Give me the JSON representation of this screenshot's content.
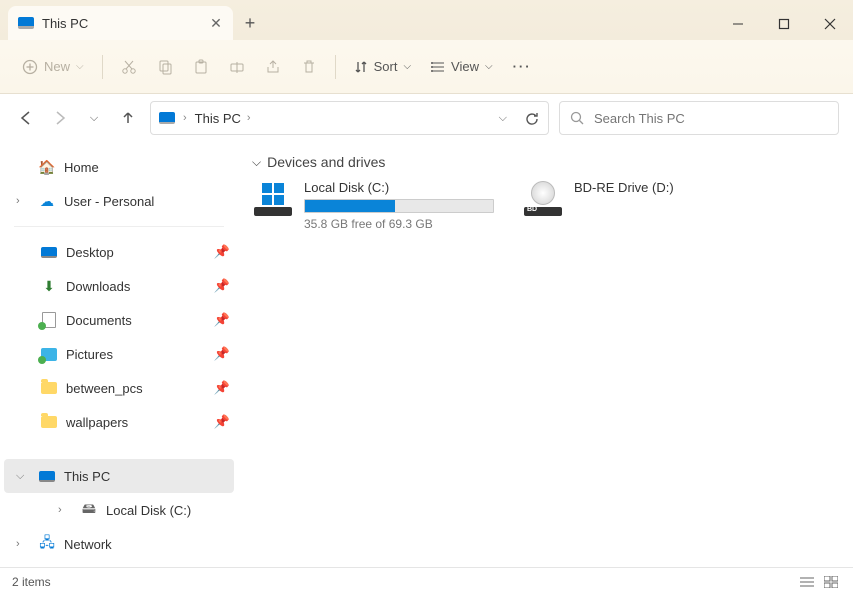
{
  "tab": {
    "title": "This PC"
  },
  "toolbar": {
    "new_label": "New",
    "sort_label": "Sort",
    "view_label": "View"
  },
  "address": {
    "location": "This PC",
    "search_placeholder": "Search This PC"
  },
  "sidebar": {
    "home": "Home",
    "user": "User - Personal",
    "quick": [
      {
        "label": "Desktop"
      },
      {
        "label": "Downloads"
      },
      {
        "label": "Documents"
      },
      {
        "label": "Pictures"
      },
      {
        "label": "between_pcs"
      },
      {
        "label": "wallpapers"
      }
    ],
    "this_pc": "This PC",
    "local_disk": "Local Disk (C:)",
    "network": "Network"
  },
  "content": {
    "group_header": "Devices and drives",
    "drives": [
      {
        "name": "Local Disk (C:)",
        "subtext": "35.8 GB free of 69.3 GB",
        "fill_pct": 48
      },
      {
        "name": "BD-RE Drive (D:)",
        "subtext": ""
      }
    ]
  },
  "status": {
    "text": "2 items"
  }
}
